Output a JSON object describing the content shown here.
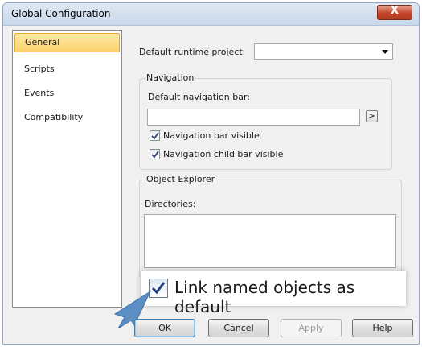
{
  "window": {
    "title": "Global Configuration",
    "close_glyph": "X"
  },
  "sidebar": {
    "items": [
      {
        "label": "General",
        "active": true
      },
      {
        "label": "Scripts",
        "active": false
      },
      {
        "label": "Events",
        "active": false
      },
      {
        "label": "Compatibility",
        "active": false
      }
    ]
  },
  "general": {
    "runtime_project_label": "Default runtime project:",
    "runtime_project_value": ""
  },
  "navigation": {
    "group_label": "Navigation",
    "default_bar_label": "Default navigation bar:",
    "default_bar_value": "",
    "browse_glyph": ">",
    "bar_visible_label": "Navigation bar visible",
    "bar_visible_checked": true,
    "child_bar_visible_label": "Navigation child bar visible",
    "child_bar_visible_checked": true
  },
  "object_explorer": {
    "group_label": "Object Explorer",
    "directories_label": "Directories:",
    "directories_value": ""
  },
  "callout": {
    "link_named_label": "Link named objects as default",
    "link_named_checked": true
  },
  "buttons": {
    "ok": "OK",
    "cancel": "Cancel",
    "apply": "Apply",
    "help": "Help"
  },
  "colors": {
    "active_item_bg": "#fcd26b",
    "close_button": "#c4452a",
    "pointer_arrow": "#5b8ec4"
  }
}
